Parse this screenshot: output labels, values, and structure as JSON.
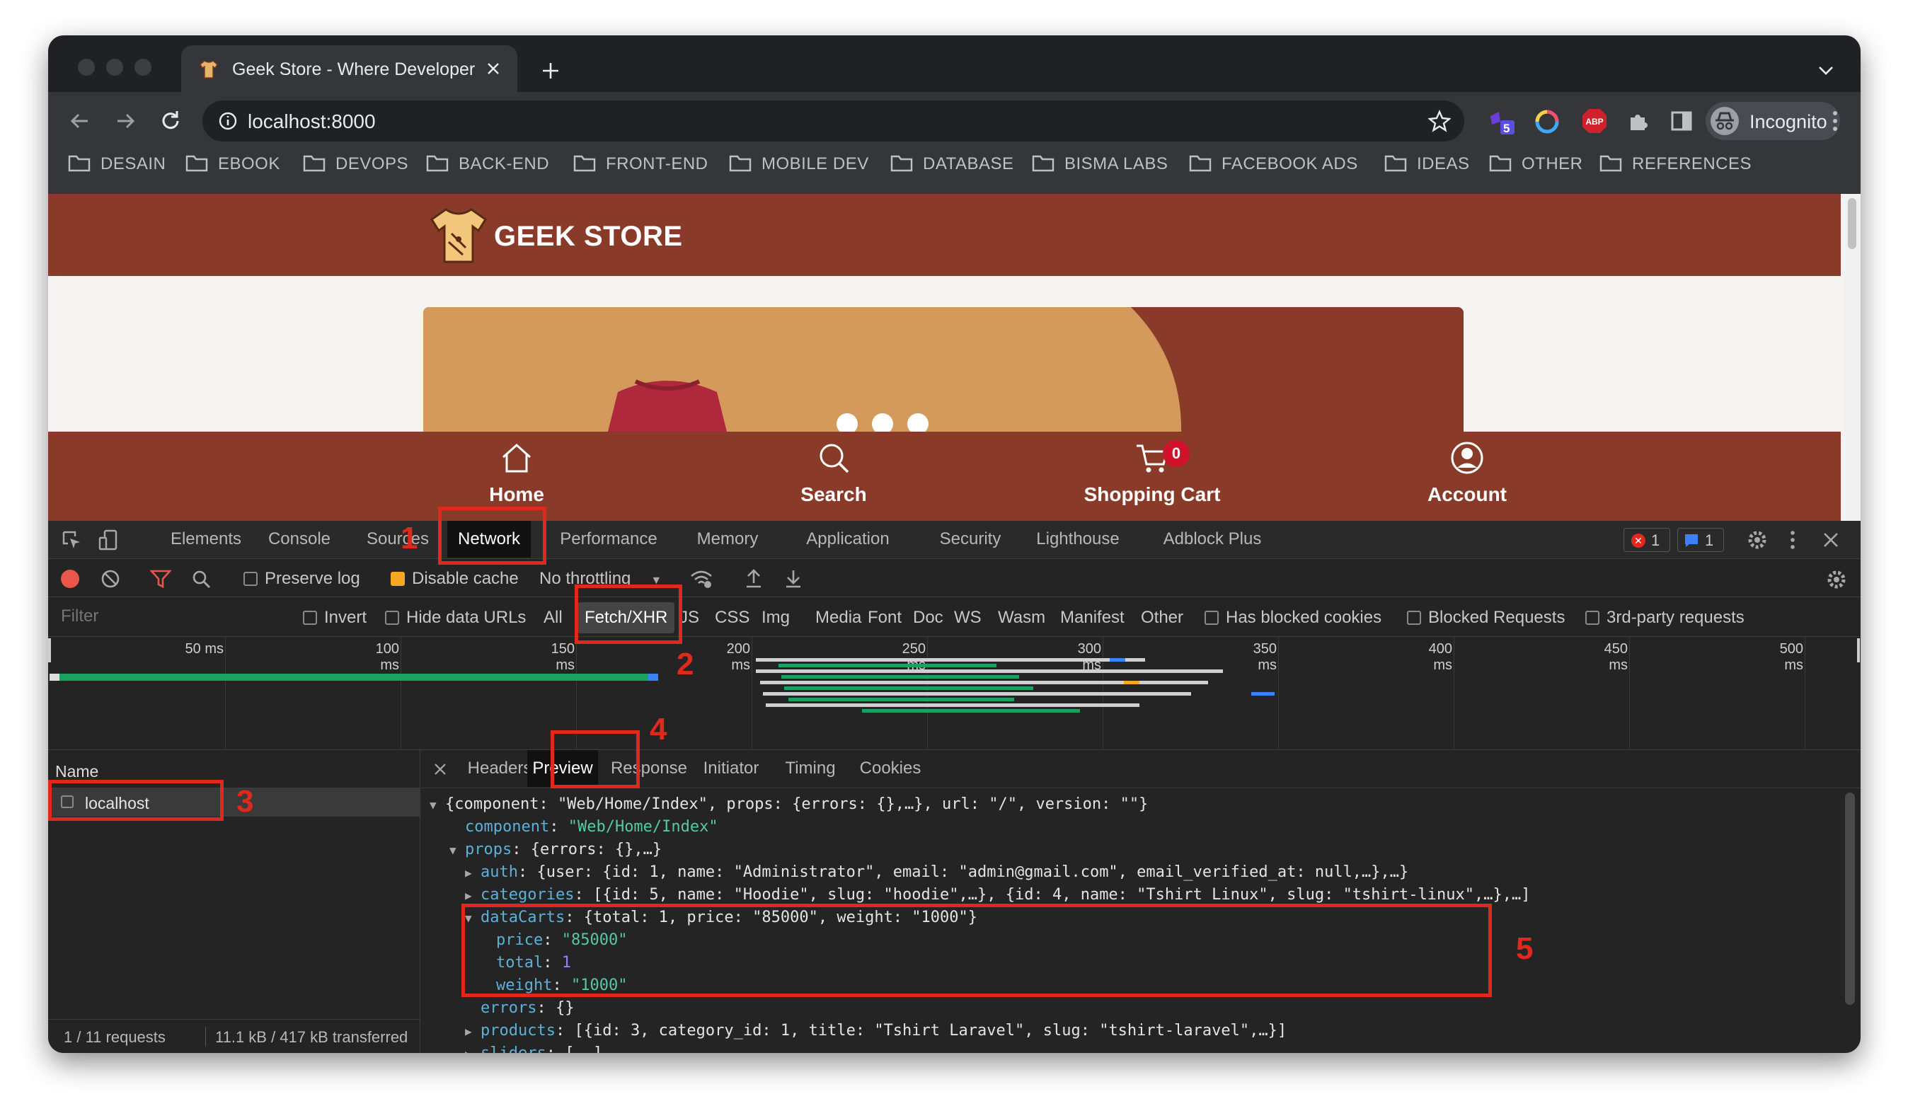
{
  "browser": {
    "tab_title": "Geek Store - Where Developer",
    "url": "localhost:8000",
    "extension_badge": "5",
    "profile_label": "Incognito",
    "bookmarks": [
      "DESAIN",
      "EBOOK",
      "DEVOPS",
      "BACK-END",
      "FRONT-END",
      "MOBILE DEV",
      "DATABASE",
      "BISMA LABS",
      "FACEBOOK ADS",
      "IDEAS",
      "OTHER",
      "REFERENCES"
    ]
  },
  "page": {
    "logo_text": "GEEK STORE",
    "nav": [
      {
        "label": "Home",
        "icon": "home-icon"
      },
      {
        "label": "Search",
        "icon": "search-icon"
      },
      {
        "label": "Shopping Cart",
        "icon": "cart-icon",
        "badge": "0"
      },
      {
        "label": "Account",
        "icon": "account-icon"
      }
    ],
    "colors": {
      "brand": "#8a3a28",
      "banner_accent": "#d39a5c",
      "shirt": "#b0283c"
    }
  },
  "devtools": {
    "tabs": [
      "Elements",
      "Console",
      "Sources",
      "Network",
      "Performance",
      "Memory",
      "Application",
      "Security",
      "Lighthouse",
      "Adblock Plus"
    ],
    "active_tab": "Network",
    "errors_count": "1",
    "messages_count": "1",
    "toolbar": {
      "preserve_log": "Preserve log",
      "disable_cache": "Disable cache",
      "throttling": "No throttling"
    },
    "filter_bar": {
      "placeholder": "Filter",
      "invert": "Invert",
      "hide_data_urls": "Hide data URLs",
      "types": [
        "All",
        "Fetch/XHR",
        "JS",
        "CSS",
        "Img",
        "Media",
        "Font",
        "Doc",
        "WS",
        "Wasm",
        "Manifest",
        "Other"
      ],
      "active_type": "Fetch/XHR",
      "has_blocked_cookies": "Has blocked cookies",
      "blocked_requests": "Blocked Requests",
      "third_party": "3rd-party requests"
    },
    "timeline_ticks": [
      "50 ms",
      "100 ms",
      "150 ms",
      "200 ms",
      "250 ms",
      "300 ms",
      "350 ms",
      "400 ms",
      "450 ms",
      "500 ms"
    ],
    "requests": {
      "header": "Name",
      "items": [
        "localhost"
      ],
      "status": "1 / 11 requests",
      "transfer": "11.1 kB / 417 kB transferred"
    },
    "detail_tabs": [
      "Headers",
      "Preview",
      "Response",
      "Initiator",
      "Timing",
      "Cookies"
    ],
    "active_detail_tab": "Preview",
    "preview": {
      "root": "{component: \"Web/Home/Index\", props: {errors: {},…}, url: \"/\", version: \"\"}",
      "component_key": "component",
      "component_val": "\"Web/Home/Index\"",
      "props_key": "props",
      "props_val": "{errors: {},…}",
      "auth_key": "auth",
      "auth_val": "{user: {id: 1, name: \"Administrator\", email: \"admin@gmail.com\", email_verified_at: null,…},…}",
      "categories_key": "categories",
      "categories_val": "[{id: 5, name: \"Hoodie\", slug: \"hoodie\",…}, {id: 4, name: \"Tshirt Linux\", slug: \"tshirt-linux\",…},…]",
      "datacarts_key": "dataCarts",
      "datacarts_val": "{total: 1, price: \"85000\", weight: \"1000\"}",
      "price_key": "price",
      "price_val": "\"85000\"",
      "total_key": "total",
      "total_val": "1",
      "weight_key": "weight",
      "weight_val": "\"1000\"",
      "errors_key": "errors",
      "errors_val": "{}",
      "products_key": "products",
      "products_val": "[{id: 3, category_id: 1, title: \"Tshirt Laravel\", slug: \"tshirt-laravel\",…}]",
      "sliders_key": "sliders",
      "sliders_val": "[,…]"
    }
  },
  "annotations": [
    "1",
    "2",
    "3",
    "4",
    "5"
  ]
}
